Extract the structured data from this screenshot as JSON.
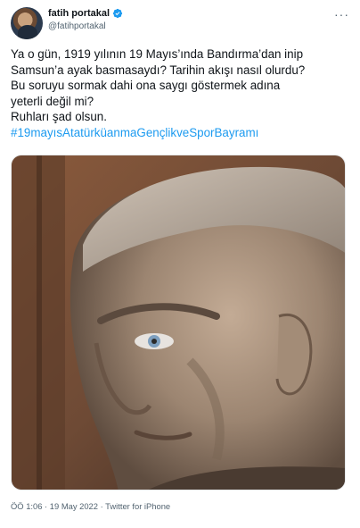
{
  "author": {
    "name": "fatih portakal",
    "handle": "@fatihportakal",
    "verified_icon": "verified-badge-icon",
    "accent_color": "#1d9bf0"
  },
  "tweet": {
    "lines": [
      "Ya o gün, 1919 yılının 19 Mayıs’ında Bandırma’dan inip",
      "Samsun’a ayak basmasaydı? Tarihin akışı nasıl olurdu?",
      "Bu soruyu sormak dahi ona saygı göstermek adına",
      "yeterli değil mi?",
      "Ruhları şad olsun."
    ],
    "hashtag": "#19mayısAtatürküanmaGençlikveSporBayramı"
  },
  "meta": {
    "time": "ÖÖ 1:06",
    "separator": "·",
    "date": "19 May 2022",
    "source": "Twitter for iPhone"
  },
  "menu_icon": "more-dots-icon"
}
